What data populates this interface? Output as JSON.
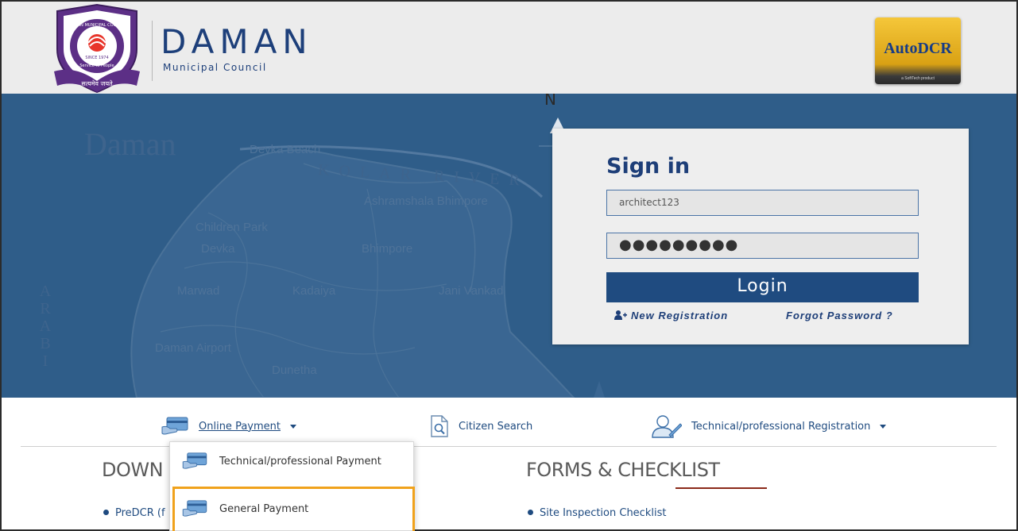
{
  "header": {
    "brand_name": "DAMAN",
    "brand_subtitle": "Municipal Council",
    "emblem_ring_text": "DAMAN MUNICIPAL COUNCIL",
    "emblem_since": "SINCE 1974",
    "emblem_motto": "Service to People",
    "emblem_ribbon": "सत्यमेव जयते",
    "partner_logo": "AutoDCR",
    "partner_logo_tagline": "a SoftTech product"
  },
  "map": {
    "title": "Daman",
    "vertical_text": [
      "A",
      "R",
      "A",
      "B",
      "I"
    ],
    "river": "KOLAR RIVER",
    "north_letter": "N",
    "places": [
      "Devka Beach",
      "Ashramshala Bhimpore",
      "Children Park",
      "Devka",
      "Bhimpore",
      "Marwad",
      "Kadaiya",
      "Jani Vankad",
      "Daman Airport",
      "Dunetha"
    ]
  },
  "signin": {
    "title": "Sign in",
    "username_value": "architect123",
    "password_value": "●●●●●●●●●",
    "login_label": "Login",
    "new_registration_label": "New Registration",
    "forgot_password_label": "Forgot Password ?"
  },
  "nav": {
    "online_payment_label": "Online Payment",
    "citizen_search_label": "Citizen Search",
    "technical_registration_label": "Technical/professional Registration"
  },
  "dropdown": {
    "items": [
      "Technical/professional Payment",
      "General Payment"
    ],
    "highlight_color": "#f0a21c"
  },
  "sections": {
    "downloads_title": "DOWN",
    "downloads_first_item": "PreDCR (f",
    "forms_title": "FORMS & CHECKLIST",
    "forms_first_item": "Site Inspection Checklist"
  },
  "colors": {
    "brand_blue": "#1d3f7a",
    "banner_blue": "#2f5d89",
    "login_button": "#1f4b80",
    "header_bg": "#ececec"
  },
  "icons": [
    "emblem-logo",
    "autodcr-logo",
    "user-plus-icon",
    "card-payment-icon",
    "document-search-icon",
    "professional-user-icon",
    "chevron-down-icon"
  ]
}
